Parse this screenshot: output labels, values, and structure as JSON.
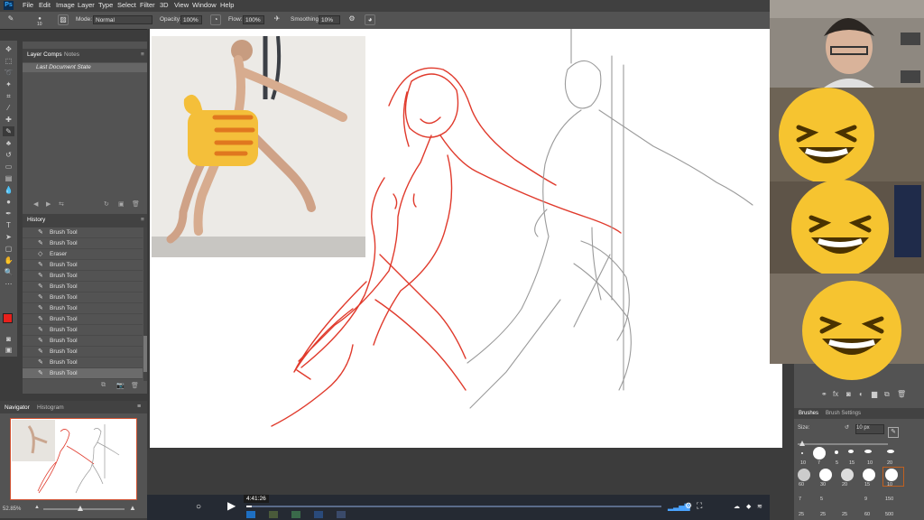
{
  "app": {
    "logo": "Ps",
    "menu": [
      "File",
      "Edit",
      "Image",
      "Layer",
      "Type",
      "Select",
      "Filter",
      "3D",
      "View",
      "Window",
      "Help"
    ]
  },
  "options_bar": {
    "brush_size": "10",
    "mode_label": "Mode:",
    "mode_value": "Normal",
    "opacity_label": "Opacity:",
    "opacity_value": "100%",
    "flow_label": "Flow:",
    "flow_value": "100%",
    "smoothing_label": "Smoothing:",
    "smoothing_value": "10%"
  },
  "layer_comps_panel": {
    "tabs": [
      "Layer Comps",
      "Notes"
    ],
    "item": "Last Document State"
  },
  "history_panel": {
    "title": "History",
    "items": [
      {
        "label": "Brush Tool",
        "icon": "brush-icon"
      },
      {
        "label": "Brush Tool",
        "icon": "brush-icon"
      },
      {
        "label": "Eraser",
        "icon": "eraser-icon"
      },
      {
        "label": "Brush Tool",
        "icon": "brush-icon"
      },
      {
        "label": "Brush Tool",
        "icon": "brush-icon"
      },
      {
        "label": "Brush Tool",
        "icon": "brush-icon"
      },
      {
        "label": "Brush Tool",
        "icon": "brush-icon"
      },
      {
        "label": "Brush Tool",
        "icon": "brush-icon"
      },
      {
        "label": "Brush Tool",
        "icon": "brush-icon"
      },
      {
        "label": "Brush Tool",
        "icon": "brush-icon"
      },
      {
        "label": "Brush Tool",
        "icon": "brush-icon"
      },
      {
        "label": "Brush Tool",
        "icon": "brush-icon"
      },
      {
        "label": "Brush Tool",
        "icon": "brush-icon"
      },
      {
        "label": "Brush Tool",
        "icon": "brush-icon"
      }
    ]
  },
  "navigator_panel": {
    "tabs": [
      "Navigator",
      "Histogram"
    ],
    "zoom": "52.85%"
  },
  "brushes_panel": {
    "tabs": [
      "Brushes",
      "Brush Settings"
    ],
    "size_label": "Size:",
    "size_value": "10 px",
    "row1_sizes": [
      "10",
      "7",
      "5",
      "15",
      "10",
      "20"
    ],
    "row2_sizes": [
      "60",
      "30",
      "20",
      "15",
      "10"
    ],
    "row3_sizes": [
      "7",
      "5",
      "9",
      "150"
    ],
    "row4_sizes": [
      "25",
      "25",
      "25",
      "60",
      "500"
    ]
  },
  "video_player": {
    "timestamp": "4:41:26"
  },
  "colors": {
    "foreground": "#e8201b",
    "background": "#ffffff",
    "sketch_red": "#e03a2c",
    "sketch_gray": "#9a9a9a",
    "emoji_yellow": "#f6c430",
    "thumb_yellow": "#f4bf3a",
    "thumb_orange": "#e0771f"
  }
}
